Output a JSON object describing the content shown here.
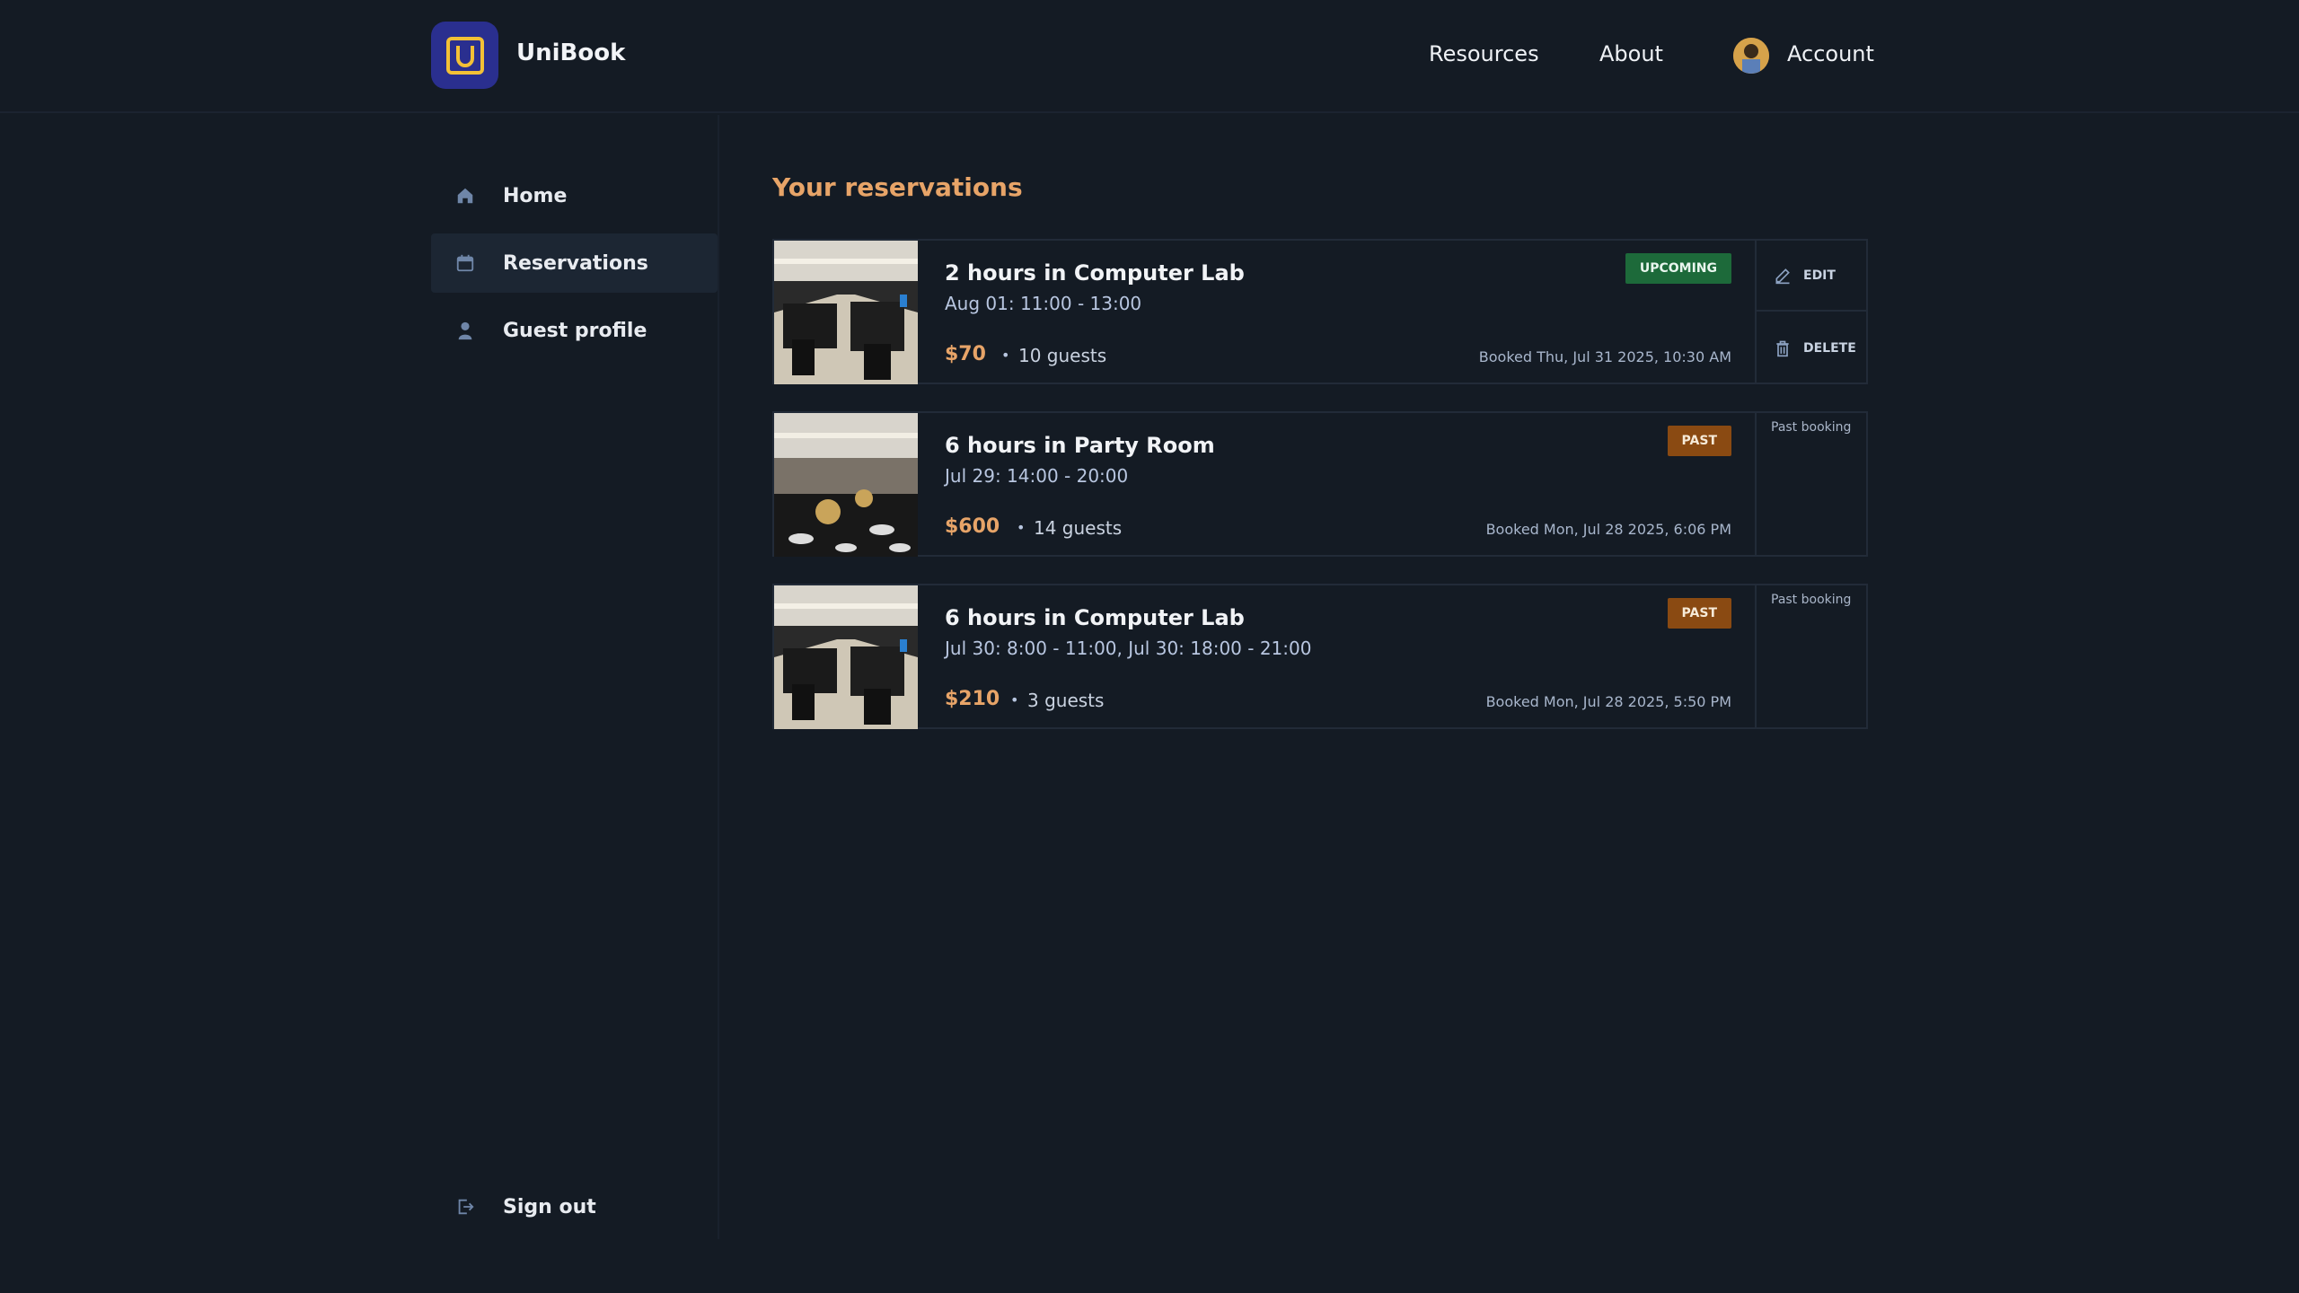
{
  "app": {
    "brand": "UniBook",
    "logo_letter": "U",
    "accent": "#e7a468",
    "logo_bg": "#2a2f8f"
  },
  "header": {
    "nav": [
      {
        "label": "Resources"
      },
      {
        "label": "About"
      },
      {
        "label": "Account"
      }
    ]
  },
  "sidebar": {
    "items": [
      {
        "label": "Home",
        "icon": "home-icon",
        "active": false
      },
      {
        "label": "Reservations",
        "icon": "calendar-icon",
        "active": true
      },
      {
        "label": "Guest profile",
        "icon": "person-icon",
        "active": false
      }
    ],
    "signout": {
      "label": "Sign out",
      "icon": "sign-out-icon"
    }
  },
  "main": {
    "title": "Your reservations",
    "reservations": [
      {
        "title": "2 hours in Computer Lab",
        "time": "Aug 01: 11:00 - 13:00",
        "price": "$70",
        "separator": "•",
        "guests": "10 guests",
        "booked": "Booked Thu, Jul 31 2025, 10:30 AM",
        "status": "UPCOMING",
        "image": "computer-lab-photo",
        "actions": {
          "edit": "EDIT",
          "delete": "DELETE"
        }
      },
      {
        "title": "6 hours in Party Room",
        "time": "Jul 29: 14:00 - 20:00",
        "price": "$600",
        "separator": "•",
        "guests": "14 guests",
        "booked": "Booked Mon, Jul 28 2025, 6:06 PM",
        "status": "PAST",
        "image": "party-room-photo",
        "note": "Past booking"
      },
      {
        "title": "6 hours in Computer Lab",
        "time": "Jul 30: 8:00 - 11:00, Jul 30: 18:00 - 21:00",
        "price": "$210",
        "separator": "•",
        "guests": "3 guests",
        "booked": "Booked Mon, Jul 28 2025, 5:50 PM",
        "status": "PAST",
        "image": "computer-lab-photo",
        "note": "Past booking"
      }
    ]
  }
}
